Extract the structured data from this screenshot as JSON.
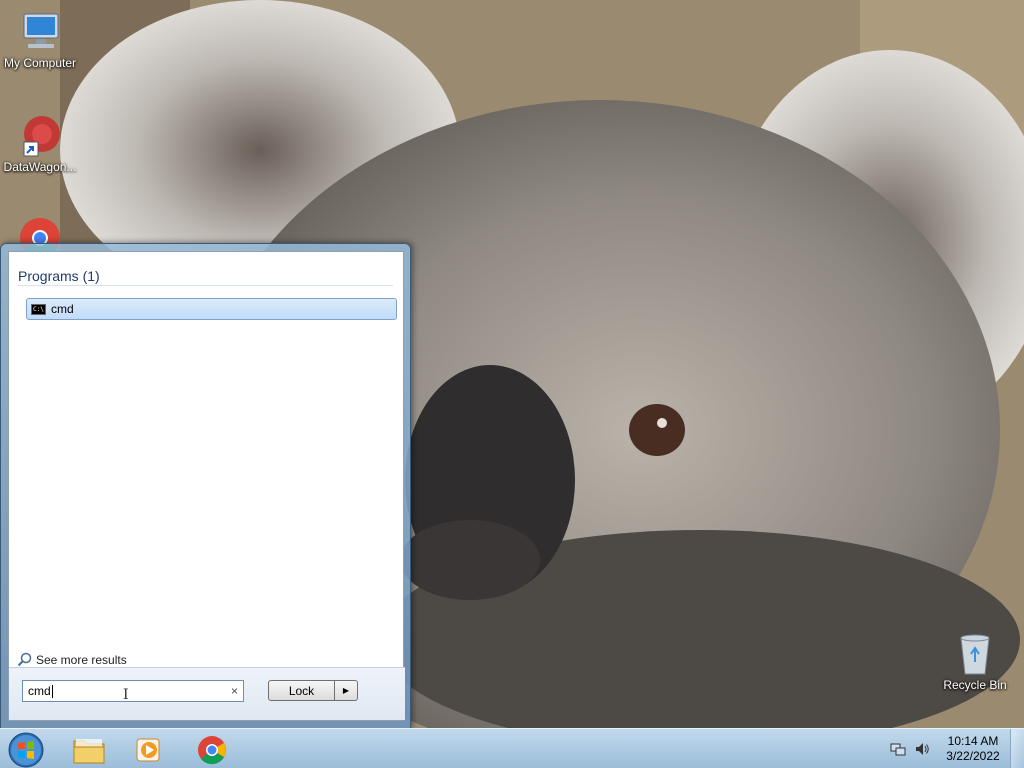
{
  "desktop": {
    "icons": [
      {
        "label": "My Computer",
        "icon": "computer-icon"
      },
      {
        "label": "DataWagon...",
        "icon": "datawagon-shortcut-icon"
      },
      {
        "label": "",
        "icon": "chrome-icon"
      },
      {
        "label": "Recycle Bin",
        "icon": "recycle-bin-icon"
      }
    ]
  },
  "start_menu": {
    "programs_header": "Programs (1)",
    "results": [
      {
        "label": "cmd",
        "icon": "cmd-icon"
      }
    ],
    "see_more": "See more results",
    "search": {
      "value": "cmd",
      "clear_symbol": "×"
    },
    "lock_label": "Lock",
    "lock_arrow": "▶"
  },
  "taskbar": {
    "pinned": [
      {
        "name": "explorer",
        "icon": "folder-icon"
      },
      {
        "name": "media-player",
        "icon": "media-player-icon"
      },
      {
        "name": "chrome",
        "icon": "chrome-icon"
      }
    ],
    "clock": {
      "time": "10:14 AM",
      "date": "3/22/2022"
    }
  },
  "colors": {
    "accent": "#1e3a6e",
    "selection": "#c1dbf8",
    "taskbar": "#a8c8e4"
  }
}
